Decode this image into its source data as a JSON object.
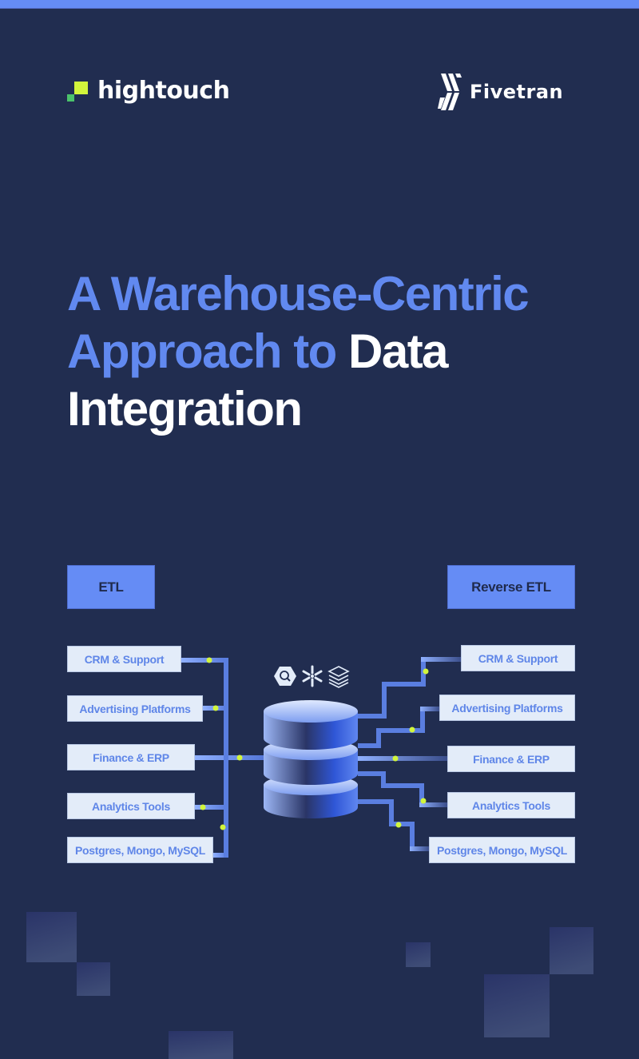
{
  "brand": {
    "hightouch": "hightouch",
    "fivetran": "Fivetran"
  },
  "title": {
    "line1_blue": "A Warehouse-Centric",
    "line2_blue": "Approach to ",
    "line2_white": "Data",
    "line3_white": "Integration"
  },
  "diagram": {
    "left_header": "ETL",
    "right_header": "Reverse ETL",
    "left_sources": [
      "CRM & Support",
      "Advertising Platforms",
      "Finance & ERP",
      "Analytics Tools",
      "Postgres, Mongo, MySQL"
    ],
    "right_destinations": [
      "CRM & Support",
      "Advertising Platforms",
      "Finance & ERP",
      "Analytics Tools",
      "Postgres, Mongo, MySQL"
    ],
    "warehouse_icons": [
      "bigquery-icon",
      "snowflake-icon",
      "databricks-icon"
    ]
  },
  "colors": {
    "background": "#212d50",
    "accent_blue": "#658cf5",
    "title_blue": "#6189f0",
    "box_fill": "#e3ecf9",
    "dot_green": "#d2f53c",
    "hightouch_lime": "#d2f53c",
    "hightouch_green": "#4bc26b"
  }
}
